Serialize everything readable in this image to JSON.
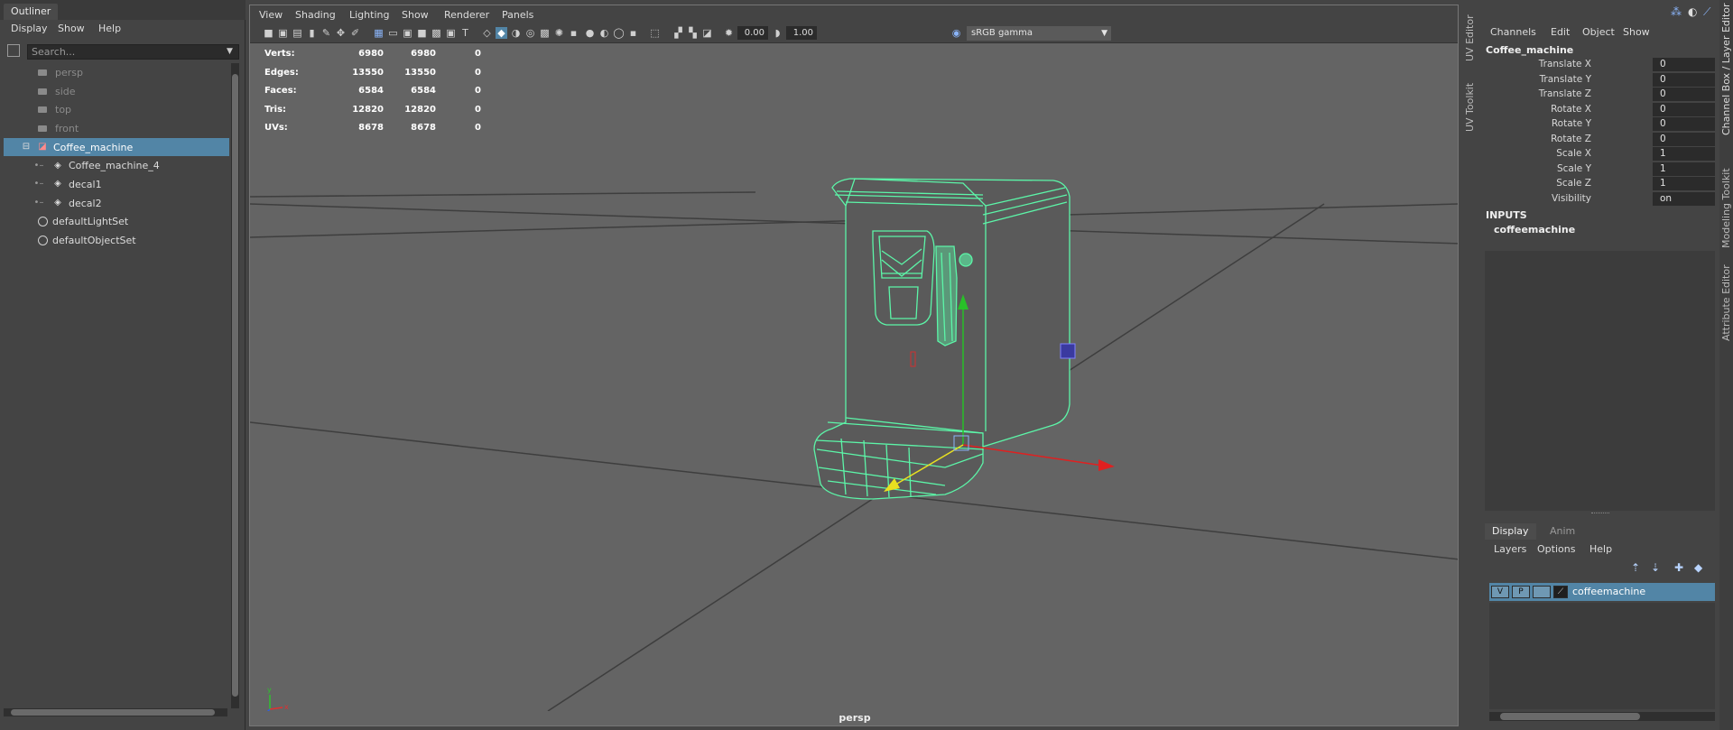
{
  "outliner": {
    "tab_label": "Outliner",
    "menu": [
      "Display",
      "Show",
      "Help"
    ],
    "search_placeholder": "Search...",
    "items": [
      {
        "label": "persp",
        "type": "camera",
        "dim": true
      },
      {
        "label": "side",
        "type": "camera",
        "dim": true
      },
      {
        "label": "top",
        "type": "camera",
        "dim": true
      },
      {
        "label": "front",
        "type": "camera",
        "dim": true
      },
      {
        "label": "Coffee_machine",
        "type": "group",
        "selected": true
      },
      {
        "label": "Coffee_machine_4",
        "type": "mesh"
      },
      {
        "label": "decal1",
        "type": "mesh"
      },
      {
        "label": "decal2",
        "type": "mesh"
      },
      {
        "label": "defaultLightSet",
        "type": "set"
      },
      {
        "label": "defaultObjectSet",
        "type": "set"
      }
    ]
  },
  "viewport": {
    "menu": [
      "View",
      "Shading",
      "Lighting",
      "Show",
      "Renderer",
      "Panels"
    ],
    "exposure": "0.00",
    "gamma": "1.00",
    "color_space": "sRGB gamma",
    "hud": [
      {
        "label": "Verts:",
        "v1": "6980",
        "v2": "6980",
        "v3": "0"
      },
      {
        "label": "Edges:",
        "v1": "13550",
        "v2": "13550",
        "v3": "0"
      },
      {
        "label": "Faces:",
        "v1": "6584",
        "v2": "6584",
        "v3": "0"
      },
      {
        "label": "Tris:",
        "v1": "12820",
        "v2": "12820",
        "v3": "0"
      },
      {
        "label": "UVs:",
        "v1": "8678",
        "v2": "8678",
        "v3": "0"
      }
    ],
    "camera_label": "persp",
    "axis": {
      "x": "x",
      "y": "y",
      "z": "z"
    }
  },
  "side_tabs": {
    "uv_editor": "UV Editor",
    "uv_toolkit": "UV Toolkit",
    "channel_layer": "Channel Box / Layer Editor",
    "modeling_toolkit": "Modeling Toolkit",
    "attribute_editor": "Attribute Editor"
  },
  "channel_box": {
    "menu": [
      "Channels",
      "Edit",
      "Object",
      "Show"
    ],
    "object_name": "Coffee_machine",
    "attributes": [
      {
        "name": "Translate X",
        "value": "0"
      },
      {
        "name": "Translate Y",
        "value": "0"
      },
      {
        "name": "Translate Z",
        "value": "0"
      },
      {
        "name": "Rotate X",
        "value": "0"
      },
      {
        "name": "Rotate Y",
        "value": "0"
      },
      {
        "name": "Rotate Z",
        "value": "0"
      },
      {
        "name": "Scale X",
        "value": "1"
      },
      {
        "name": "Scale Y",
        "value": "1"
      },
      {
        "name": "Scale Z",
        "value": "1"
      },
      {
        "name": "Visibility",
        "value": "on"
      }
    ],
    "inputs_header": "INPUTS",
    "inputs_node": "coffeemachine"
  },
  "layer_editor": {
    "tabs": [
      "Display",
      "Anim"
    ],
    "menu": [
      "Layers",
      "Options",
      "Help"
    ],
    "layer": {
      "visible": "V",
      "playback": "P",
      "name": "coffeemachine"
    }
  },
  "colors": {
    "selection": "#5285a6",
    "wireframe": "#5cf5a8",
    "viewport_bg": "#646464",
    "panel_bg": "#444444"
  }
}
